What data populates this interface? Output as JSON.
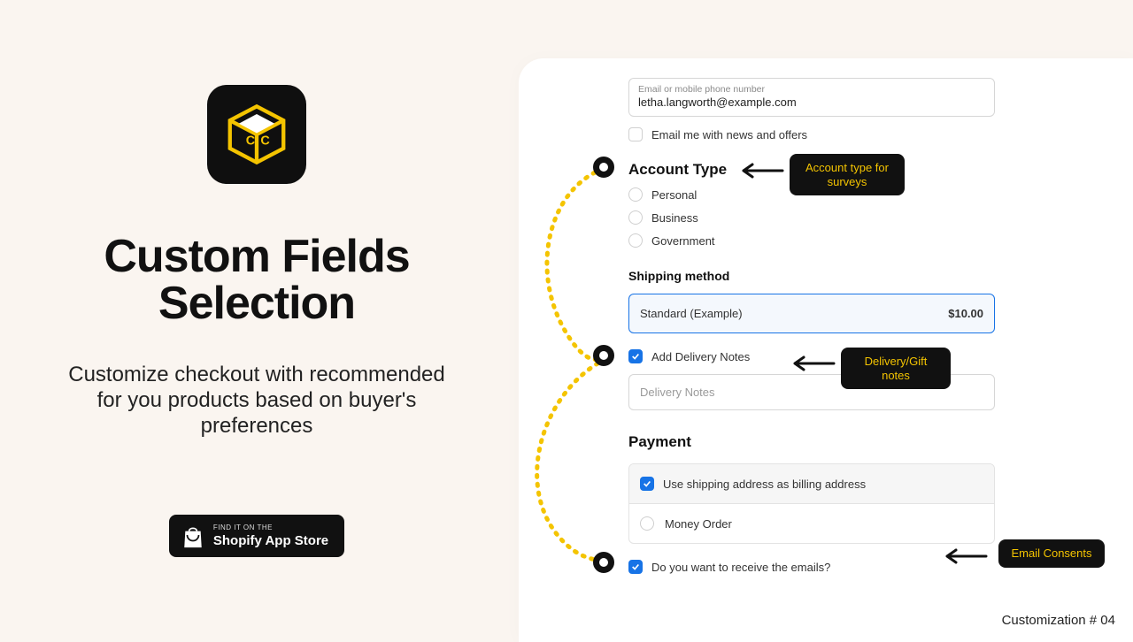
{
  "left": {
    "title_line1": "Custom Fields",
    "title_line2": "Selection",
    "subtitle": "Customize checkout with recommended for you products based on buyer's preferences",
    "store_line1": "FIND IT ON THE",
    "store_line2": "Shopify App Store"
  },
  "form": {
    "email_label": "Email or mobile phone number",
    "email_value": "letha.langworth@example.com",
    "email_me": "Email me with news and offers",
    "account_type_heading": "Account Type",
    "account_types": [
      "Personal",
      "Business",
      "Government"
    ],
    "shipping_heading": "Shipping method",
    "shipping_option": "Standard (Example)",
    "shipping_price": "$10.00",
    "add_delivery_notes": "Add Delivery Notes",
    "delivery_notes_placeholder": "Delivery Notes",
    "payment_heading": "Payment",
    "use_shipping_as_billing": "Use shipping address as billing address",
    "money_order": "Money Order",
    "receive_emails": "Do you want to receive the emails?"
  },
  "callouts": {
    "account": "Account type for surveys",
    "delivery": "Delivery/Gift notes",
    "emails": "Email Consents"
  },
  "footer": "Customization # 04",
  "colors": {
    "accent": "#f4c400",
    "blue": "#1773e6"
  }
}
